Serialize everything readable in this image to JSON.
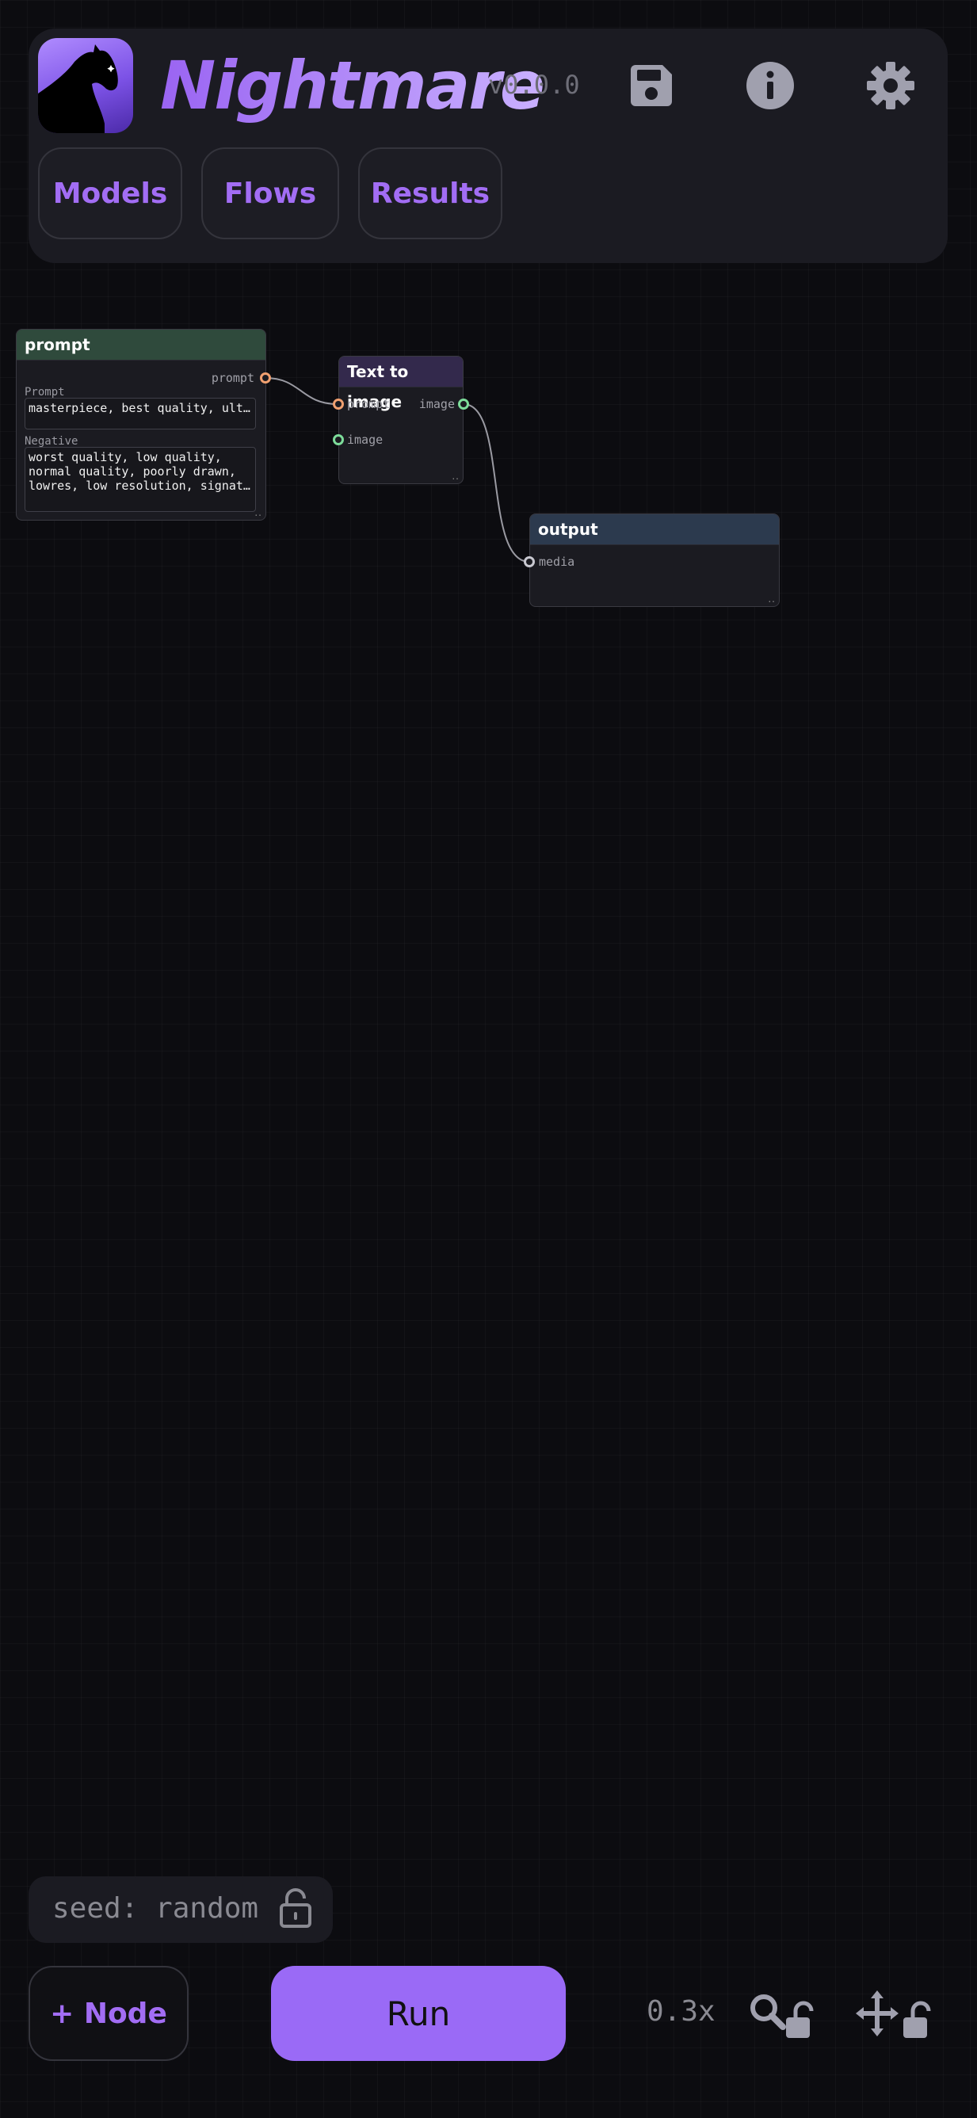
{
  "header": {
    "app_title": "Nightmare",
    "version": "v0.0.0",
    "nav": [
      {
        "label": "Models"
      },
      {
        "label": "Flows"
      },
      {
        "label": "Results"
      }
    ],
    "icons": [
      "save-icon",
      "info-icon",
      "gear-icon"
    ]
  },
  "canvas": {
    "nodes": {
      "prompt": {
        "title": "prompt",
        "output_port": "prompt",
        "fields": [
          {
            "label": "Prompt",
            "value": "masterpiece, best quality, ult…"
          },
          {
            "label": "Negative",
            "value": "worst quality, low quality,\nnormal quality, poorly drawn,\nlowres, low resolution, signat…"
          }
        ]
      },
      "text_to_image": {
        "title": "Text to image",
        "input_ports": [
          "prompt",
          "image"
        ],
        "output_port": "image"
      },
      "output": {
        "title": "output",
        "input_port": "media"
      }
    }
  },
  "footer": {
    "seed": "seed: random",
    "add_node_label": "+ Node",
    "run_label": "Run",
    "zoom": "0.3x"
  },
  "colors": {
    "accent": "#9a6af6",
    "prompt_port": "#f0a070",
    "image_port": "#7ddc9a",
    "prompt_node_header": "#2f4a3c",
    "t2i_node_header": "#33294c",
    "output_node_header": "#2c3a4e"
  }
}
